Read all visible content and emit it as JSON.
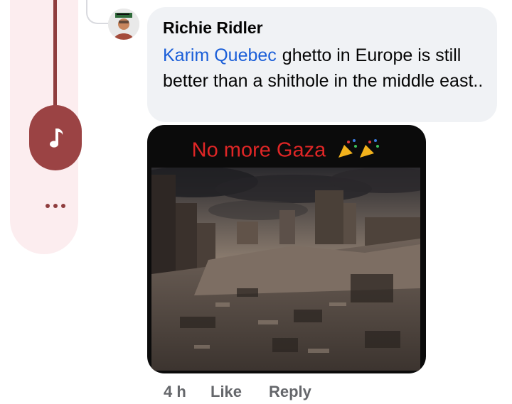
{
  "comment": {
    "author": "Richie Ridler",
    "mention": "Karim Quebec",
    "text": "ghetto in Europe is still better than a shithole in the middle east.."
  },
  "attachment": {
    "caption": "No more Gaza",
    "caption_icon": "party-popper-icon",
    "image_subject": "rubble-photo"
  },
  "actions": {
    "time": "4 h",
    "like_label": "Like",
    "reply_label": "Reply"
  },
  "sidebar": {
    "music_icon": "music-note-icon",
    "more_icon": "more-dots-icon"
  },
  "colors": {
    "bubble_bg": "#f0f2f5",
    "mention": "#1a5ed8",
    "caption": "#e02626",
    "meta_text": "#65676b",
    "sidebar_accent": "#9b4344",
    "sidebar_bg": "#fcedef"
  }
}
